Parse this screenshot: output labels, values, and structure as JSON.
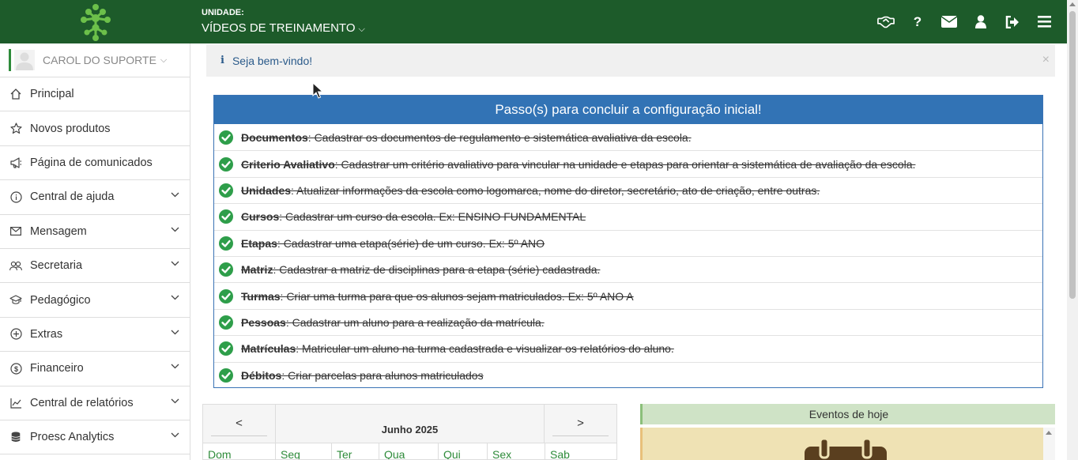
{
  "header": {
    "unit_label": "UNIDADE:",
    "unit_value": "VÍDEOS DE TREINAMENTO",
    "icons": [
      "handshake-icon",
      "question-icon",
      "envelope-icon",
      "user-icon",
      "sign-out-icon",
      "menu-icon"
    ]
  },
  "sidebar": {
    "user_name": "CAROL DO SUPORTE",
    "items": [
      {
        "label": "Principal",
        "icon": "home-icon",
        "expandable": false
      },
      {
        "label": "Novos produtos",
        "icon": "star-icon",
        "expandable": false
      },
      {
        "label": "Página de comunicados",
        "icon": "megaphone-icon",
        "expandable": false
      },
      {
        "label": "Central de ajuda",
        "icon": "info-icon",
        "expandable": true
      },
      {
        "label": "Mensagem",
        "icon": "envelope-icon",
        "expandable": true
      },
      {
        "label": "Secretaria",
        "icon": "users-icon",
        "expandable": true
      },
      {
        "label": "Pedagógico",
        "icon": "graduation-cap-icon",
        "expandable": true
      },
      {
        "label": "Extras",
        "icon": "plus-circle-icon",
        "expandable": true
      },
      {
        "label": "Financeiro",
        "icon": "dollar-circle-icon",
        "expandable": true
      },
      {
        "label": "Central de relatórios",
        "icon": "line-chart-icon",
        "expandable": true
      },
      {
        "label": "Proesc Analytics",
        "icon": "database-icon",
        "expandable": true
      }
    ]
  },
  "alert": {
    "icon": "info-icon",
    "text": "Seja bem-vindo!",
    "close": "×"
  },
  "steps": {
    "title": "Passo(s) para concluir a configuração inicial!",
    "items": [
      {
        "name": "Documentos",
        "desc": ": Cadastrar os documentos de regulamento e sistemática avaliativa da escola."
      },
      {
        "name": "Criterio Avaliativo",
        "desc": ": Cadastrar um critério avaliativo para vincular na unidade e etapas para orientar a sistemática de avaliação da escola."
      },
      {
        "name": "Unidades",
        "desc": ": Atualizar informações da escola como logomarca, nome do diretor, secretário, ato de criação, entre outras."
      },
      {
        "name": "Cursos",
        "desc": ": Cadastrar um curso da escola. Ex: ENSINO FUNDAMENTAL"
      },
      {
        "name": "Etapas",
        "desc": ": Cadastrar uma etapa(série) de um curso. Ex: 5º ANO"
      },
      {
        "name": "Matriz",
        "desc": ": Cadastrar a matriz de disciplinas para a etapa (série) cadastrada."
      },
      {
        "name": "Turmas",
        "desc": ": Criar uma turma para que os alunos sejam matriculados. Ex: 5º ANO A"
      },
      {
        "name": "Pessoas",
        "desc": ": Cadastrar um aluno para a realização da matrícula."
      },
      {
        "name": "Matrículas",
        "desc": ": Matricular um aluno na turma cadastrada e visualizar os relatórios do aluno."
      },
      {
        "name": "Débitos",
        "desc": ": Criar parcelas para alunos matriculados"
      }
    ]
  },
  "calendar": {
    "prev": "<",
    "next": ">",
    "title": "Junho 2025",
    "days": [
      "Dom",
      "Seg",
      "Ter",
      "Qua",
      "Qui",
      "Sex",
      "Sab"
    ]
  },
  "events": {
    "title": "Eventos de hoje",
    "icon": "calendar-icon"
  },
  "colors": {
    "topbar": "#1d5b2a",
    "accent_green": "#2e8b3a",
    "steps_header": "#3273b5",
    "alert_text": "#2a5a8a",
    "events_head": "#cfe3c6",
    "events_body": "#efe2b4"
  }
}
